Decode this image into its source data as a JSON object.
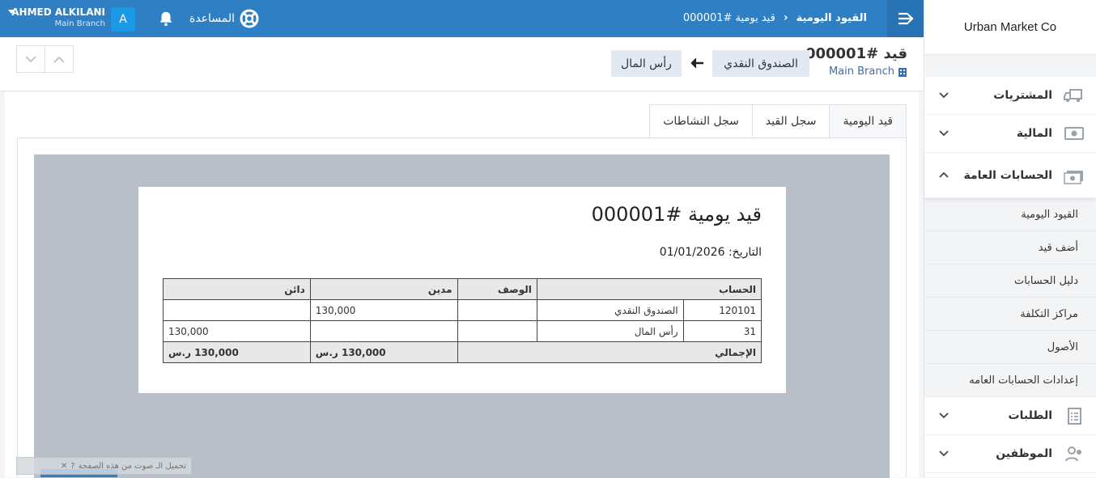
{
  "topbar": {
    "user_name": "AHMED ALKILANI",
    "user_branch": "Main Branch",
    "avatar_letter": "A",
    "help_label": "المساعدة",
    "breadcrumb": [
      "القيود اليومية",
      "قيد يومية #000001"
    ],
    "color": "#2e7fc4"
  },
  "sidebar": {
    "company": "Urban Market Co",
    "items": [
      {
        "label": "المشتريات",
        "icon": "truck-icon"
      },
      {
        "label": "المالية",
        "icon": "money-icon"
      },
      {
        "label": "الحسابات العامة",
        "icon": "cash-icon"
      }
    ],
    "sub_items": [
      "القيود اليومية",
      "أضف قيد",
      "دليل الحسابات",
      "مراكز التكلفة",
      "الأصول",
      "إعدادات الحسابات العامه"
    ],
    "bottom_items": [
      {
        "label": "الطلبات",
        "icon": "clipboard-icon"
      },
      {
        "label": "الموظفين",
        "icon": "users-icon"
      }
    ]
  },
  "header": {
    "title": "قيد #000001",
    "branch": "Main Branch",
    "from_account": "الصندوق النقدي",
    "to_account": "رأس المال"
  },
  "tabs": [
    "قيد اليومية",
    "سجل القيد",
    "سجل النشاطات"
  ],
  "document": {
    "title": "قيد يومية #000001",
    "date_label": "التاريخ:",
    "date_value": "01/01/2026",
    "columns": [
      "الحساب",
      "الوصف",
      "مدين",
      "دائن"
    ],
    "rows": [
      {
        "code": "120101",
        "account": "الصندوق النقدي",
        "description": "",
        "debit": "130,000",
        "credit": ""
      },
      {
        "code": "31",
        "account": "رأس المال",
        "description": "",
        "debit": "",
        "credit": "130,000"
      }
    ],
    "total_label": "الإجمالي",
    "total_debit": "130,000 ر.س",
    "total_credit": "130,000 ر.س"
  },
  "watermark_text": "تحميل الـ صوت من هذه الصفحة"
}
